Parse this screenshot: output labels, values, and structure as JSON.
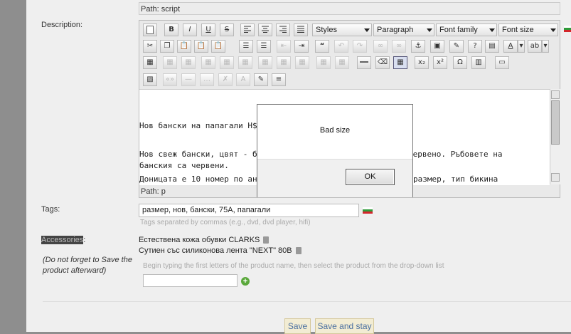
{
  "path_top": "Path: script",
  "description_label": "Description:",
  "toolbar": {
    "styles": "Styles",
    "paragraph": "Paragraph",
    "font_family": "Font family",
    "font_size": "Font size"
  },
  "editor": {
    "lines": [
      "Нов бански на папагали H$M",
      "Нов свеж бански, цвят - бял",
      "червено. Ръбовете на",
      "банския са червени.",
      "Доницата е 10 номер по анг",
      "размер, тип бикина"
    ],
    "path": "Path: p"
  },
  "tags": {
    "label": "Tags:",
    "value": "размер, нов, бански, 75A, папагали",
    "hint": "Tags separated by commas (e.g., dvd, dvd player, hifi)"
  },
  "accessories": {
    "label": "Accessories",
    "colon": ":",
    "note": "(Do not forget to Save the product afterward)",
    "items": [
      "Естествена кожа обувки CLARKS",
      "Сутиен със силиконова лента \"NEXT\" 80B"
    ],
    "search_hint": "Begin typing the first letters of the product name, then select the product from the drop-down list"
  },
  "buttons": {
    "save": "Save",
    "save_and_stay": "Save and stay"
  },
  "modal": {
    "message": "Bad size",
    "ok": "OK"
  },
  "colors": {
    "flag_white": "#ffffff",
    "flag_green": "#2f9a3a",
    "flag_red": "#d3262b",
    "button_text": "#4a6fa0"
  }
}
